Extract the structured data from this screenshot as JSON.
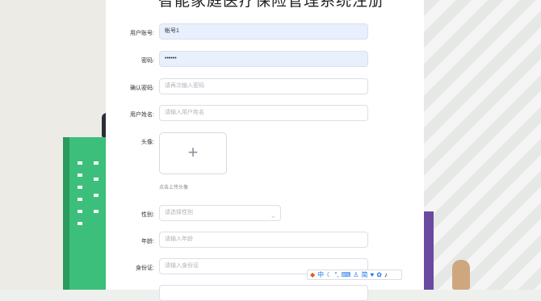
{
  "page": {
    "title": "智能家庭医疗保险管理系统注册"
  },
  "form": {
    "account": {
      "label": "用户账号:",
      "value": "帐号1"
    },
    "password": {
      "label": "密码:",
      "value": "••••••"
    },
    "confirm_password": {
      "label": "确认密码:",
      "placeholder": "请再次输入密码"
    },
    "user_name": {
      "label": "用户姓名:",
      "placeholder": "请输入用户姓名"
    },
    "avatar": {
      "label": "头像:",
      "hint": "点击上传头像"
    },
    "gender": {
      "label": "性别:",
      "placeholder": "请选择性别"
    },
    "age": {
      "label": "年龄:",
      "placeholder": "请输入年龄"
    },
    "id_card": {
      "label": "身份证:",
      "placeholder": "请输入身份证"
    }
  },
  "ime_toolbar": {
    "items": [
      "中",
      "简"
    ]
  },
  "colors": {
    "autofill_bg": "#e8f0fe",
    "border": "#dcdfe6",
    "building_green": "#3bbf7a"
  }
}
